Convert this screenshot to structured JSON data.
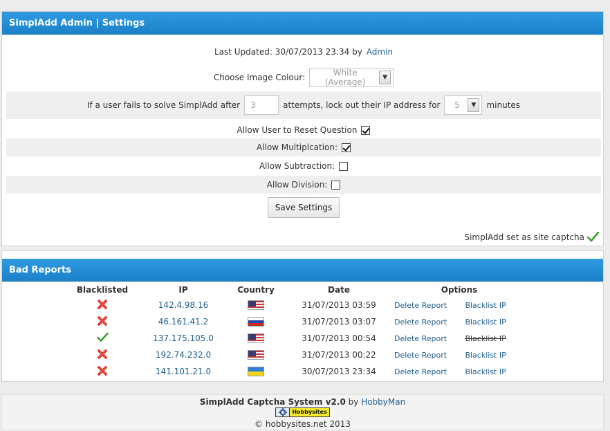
{
  "settings": {
    "header": "SimplAdd Admin | Settings",
    "last_updated_label": "Last Updated: 30/07/2013 23:34 by",
    "last_updated_user": "Admin",
    "image_colour_label": "Choose Image Colour:",
    "image_colour_value": "White (Average)",
    "lockout_prefix": "If a user fails to solve SimplAdd after",
    "lockout_attempts": "3",
    "lockout_middle": "attempts, lock out their IP address for",
    "lockout_minutes": "5",
    "lockout_suffix": "minutes",
    "allow_reset_label": "Allow User to Reset Question",
    "allow_reset_checked": true,
    "allow_multiplication_label": "Allow Multiplcation:",
    "allow_multiplication_checked": true,
    "allow_subtraction_label": "Allow Subtraction:",
    "allow_subtraction_checked": false,
    "allow_division_label": "Allow Division:",
    "allow_division_checked": false,
    "save_label": "Save Settings",
    "captcha_status": "SimplAdd set as site captcha"
  },
  "reports": {
    "header": "Bad Reports",
    "columns": {
      "blacklisted": "Blacklisted",
      "ip": "IP",
      "country": "Country",
      "date": "Date",
      "options": "Options"
    },
    "rows": [
      {
        "blacklisted": false,
        "ip": "142.4.98.16",
        "country_flag": "us-flag-icon",
        "date": "31/07/2013 03:59",
        "delete_label": "Delete Report",
        "blacklist_label": "Blacklist IP",
        "blacklist_struck": false
      },
      {
        "blacklisted": false,
        "ip": "46.161.41.2",
        "country_flag": "ru-flag-icon",
        "date": "31/07/2013 03:07",
        "delete_label": "Delete Report",
        "blacklist_label": "Blacklist IP",
        "blacklist_struck": false
      },
      {
        "blacklisted": true,
        "ip": "137.175.105.0",
        "country_flag": "us-flag-icon",
        "date": "31/07/2013 00:54",
        "delete_label": "Delete Report",
        "blacklist_label": "Blacklist IP",
        "blacklist_struck": true
      },
      {
        "blacklisted": false,
        "ip": "192.74.232.0",
        "country_flag": "us-flag-icon",
        "date": "31/07/2013 00:22",
        "delete_label": "Delete Report",
        "blacklist_label": "Blacklist IP",
        "blacklist_struck": false
      },
      {
        "blacklisted": false,
        "ip": "141.101.21.0",
        "country_flag": "ua-flag-icon",
        "date": "30/07/2013 23:34",
        "delete_label": "Delete Report",
        "blacklist_label": "Blacklist IP",
        "blacklist_struck": false
      }
    ]
  },
  "footer": {
    "product": "SimplAdd Captcha System v2.0",
    "by": "by",
    "author": "HobbyMan",
    "badge_text": "Hobbysites",
    "copyright": "© hobbysites.net 2013"
  },
  "colors": {
    "header_blue": "#1b81c9",
    "link": "#21608f",
    "check_green": "#3aa033",
    "cross_red": "#d9201a"
  }
}
